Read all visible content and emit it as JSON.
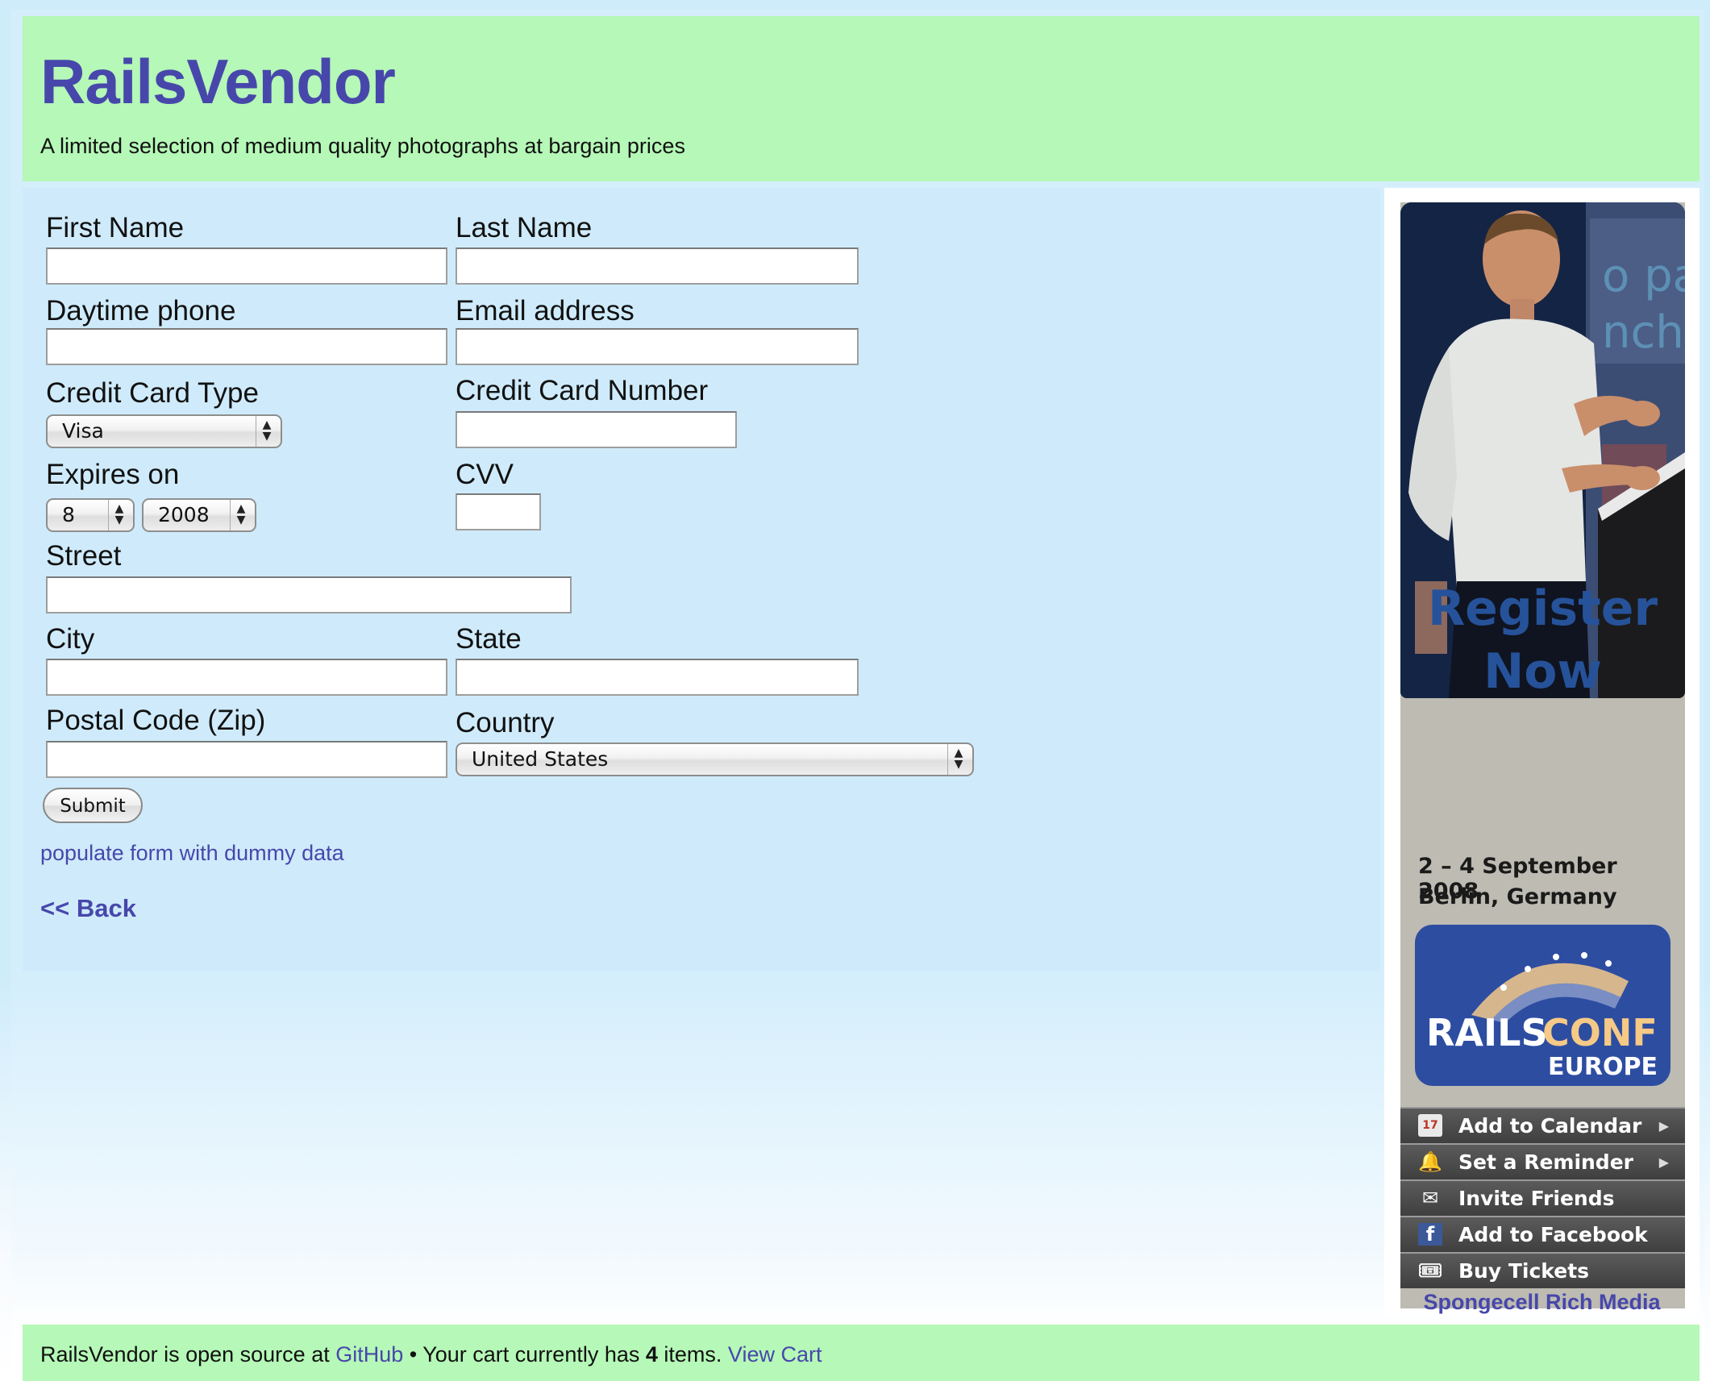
{
  "header": {
    "title": "RailsVendor",
    "tagline": "A limited selection of medium quality photographs at bargain prices"
  },
  "form": {
    "first_name_label": "First Name",
    "first_name_value": "",
    "last_name_label": "Last Name",
    "last_name_value": "",
    "phone_label": "Daytime phone",
    "phone_value": "",
    "email_label": "Email address",
    "email_value": "",
    "card_type_label": "Credit Card Type",
    "card_type_value": "Visa",
    "card_number_label": "Credit Card Number",
    "card_number_value": "",
    "expires_label": "Expires on",
    "expires_month": "8",
    "expires_year": "2008",
    "cvv_label": "CVV",
    "cvv_value": "",
    "street_label": "Street",
    "street_value": "",
    "city_label": "City",
    "city_value": "",
    "state_label": "State",
    "state_value": "",
    "postal_label": "Postal Code (Zip)",
    "postal_value": "",
    "country_label": "Country",
    "country_value": "United States",
    "submit_label": "Submit"
  },
  "links": {
    "dummy": "populate form with dummy data",
    "back": "<< Back"
  },
  "ad": {
    "photo_text": "o pa nch",
    "register_line1": "Register",
    "register_line2": "Now",
    "date_line": "2 – 4  September 2008",
    "location_line": "Berlin, Germany",
    "logo_main_prefix": "RAILS",
    "logo_main_suffix": "CONF",
    "logo_sub": "EUROPE",
    "menu": [
      {
        "label": "Add to Calendar",
        "icon": "calendar-icon",
        "glyph": "17"
      },
      {
        "label": "Set a Reminder",
        "icon": "bell-icon",
        "glyph": "🔔"
      },
      {
        "label": "Invite Friends",
        "icon": "envelope-icon",
        "glyph": "✉"
      },
      {
        "label": "Add to Facebook",
        "icon": "facebook-icon",
        "glyph": "f"
      },
      {
        "label": "Buy Tickets",
        "icon": "ticket-icon",
        "glyph": "🎟"
      }
    ],
    "credit": "Spongecell Rich Media"
  },
  "footer": {
    "prefix": "RailsVendor is open source at ",
    "github": "GitHub",
    "middle": " • Your cart currently has ",
    "count": "4",
    "suffix": " items. ",
    "view_cart": "View Cart"
  },
  "colors": {
    "header_bg": "#b5f8b7",
    "main_bg": "#cfebfb",
    "link": "#4747ab",
    "ad_blue": "#26529a"
  }
}
